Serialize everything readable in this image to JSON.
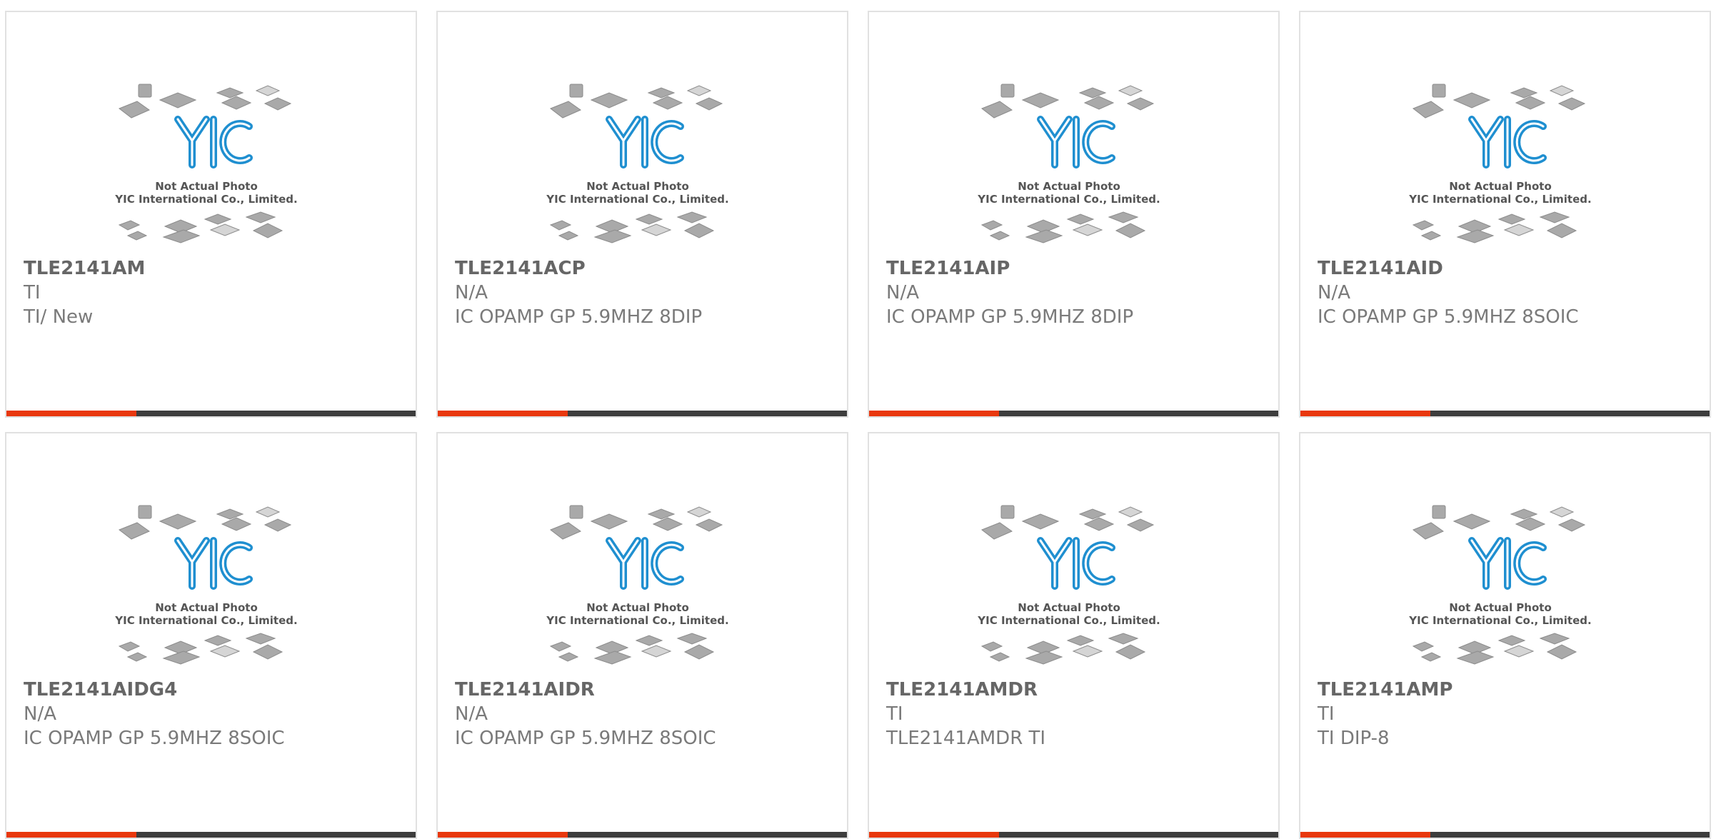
{
  "placeholder": {
    "logo_text": "YIC",
    "line1": "Not Actual Photo",
    "line2": "YIC International Co., Limited."
  },
  "colors": {
    "accent": "#e8380d",
    "bar": "#3d3d3d",
    "logo": "#1f8fd0"
  },
  "products": [
    {
      "part": "TLE2141AM",
      "manufacturer": "TI",
      "description": "TI/ New"
    },
    {
      "part": "TLE2141ACP",
      "manufacturer": "N/A",
      "description": "IC OPAMP GP 5.9MHZ 8DIP"
    },
    {
      "part": "TLE2141AIP",
      "manufacturer": "N/A",
      "description": "IC OPAMP GP 5.9MHZ 8DIP"
    },
    {
      "part": "TLE2141AID",
      "manufacturer": "N/A",
      "description": "IC OPAMP GP 5.9MHZ 8SOIC"
    },
    {
      "part": "TLE2141AIDG4",
      "manufacturer": "N/A",
      "description": "IC OPAMP GP 5.9MHZ 8SOIC"
    },
    {
      "part": "TLE2141AIDR",
      "manufacturer": "N/A",
      "description": "IC OPAMP GP 5.9MHZ 8SOIC"
    },
    {
      "part": "TLE2141AMDR",
      "manufacturer": "TI",
      "description": "TLE2141AMDR TI"
    },
    {
      "part": "TLE2141AMP",
      "manufacturer": "TI",
      "description": "TI DIP-8"
    }
  ]
}
